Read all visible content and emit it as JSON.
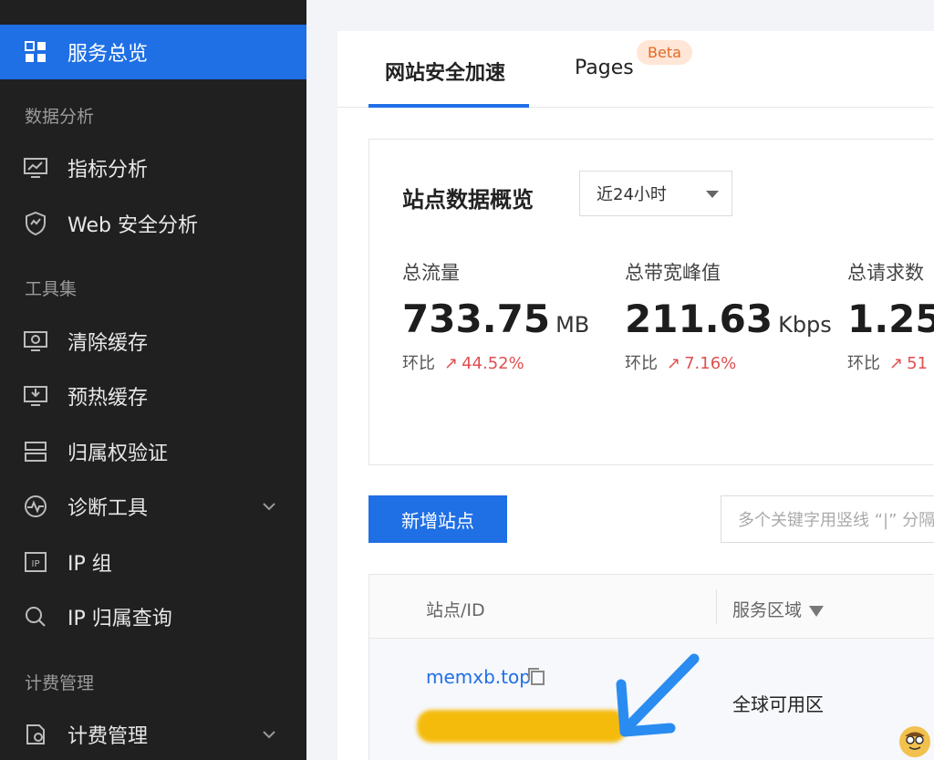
{
  "sidebar": {
    "active_item": {
      "label": "服务总览",
      "icon": "grid-icon"
    },
    "groups": [
      {
        "title": "数据分析",
        "items": [
          {
            "label": "指标分析",
            "icon": "chart-monitor-icon"
          },
          {
            "label": "Web 安全分析",
            "icon": "shield-chart-icon"
          }
        ]
      },
      {
        "title": "工具集",
        "items": [
          {
            "label": "清除缓存",
            "icon": "monitor-refresh-icon"
          },
          {
            "label": "预热缓存",
            "icon": "monitor-download-icon"
          },
          {
            "label": "归属权验证",
            "icon": "server-icon"
          },
          {
            "label": "诊断工具",
            "icon": "pulse-icon",
            "expandable": true
          },
          {
            "label": "IP 组",
            "icon": "ip-icon"
          },
          {
            "label": "IP 归属查询",
            "icon": "search-icon"
          }
        ]
      },
      {
        "title": "计费管理",
        "items": [
          {
            "label": "计费管理",
            "icon": "billing-icon",
            "expandable": true
          }
        ]
      }
    ]
  },
  "tabs": [
    {
      "label": "网站安全加速",
      "active": true
    },
    {
      "label": "Pages",
      "badge": "Beta"
    }
  ],
  "overview": {
    "title": "站点数据概览",
    "range": "近24小时",
    "metrics": [
      {
        "label": "总流量",
        "value": "733.75",
        "unit": "MB",
        "compare_label": "环比",
        "change": "44.52%"
      },
      {
        "label": "总带宽峰值",
        "value": "211.63",
        "unit": "Kbps",
        "compare_label": "环比",
        "change": "7.16%"
      },
      {
        "label": "总请求数",
        "value": "1.25",
        "unit": "",
        "compare_label": "环比",
        "change": "51"
      }
    ]
  },
  "actions": {
    "add_site": "新增站点",
    "search_placeholder": "多个关键字用竖线 “|” 分隔"
  },
  "table": {
    "columns": [
      "站点/ID",
      "服务区域"
    ],
    "rows": [
      {
        "site": "memxb.top",
        "region": "全球可用区"
      }
    ]
  },
  "colors": {
    "accent": "#1f6fe5",
    "sidebar_bg": "#202020",
    "up_change": "#e05050",
    "beta_bg": "#ffe6d6"
  }
}
